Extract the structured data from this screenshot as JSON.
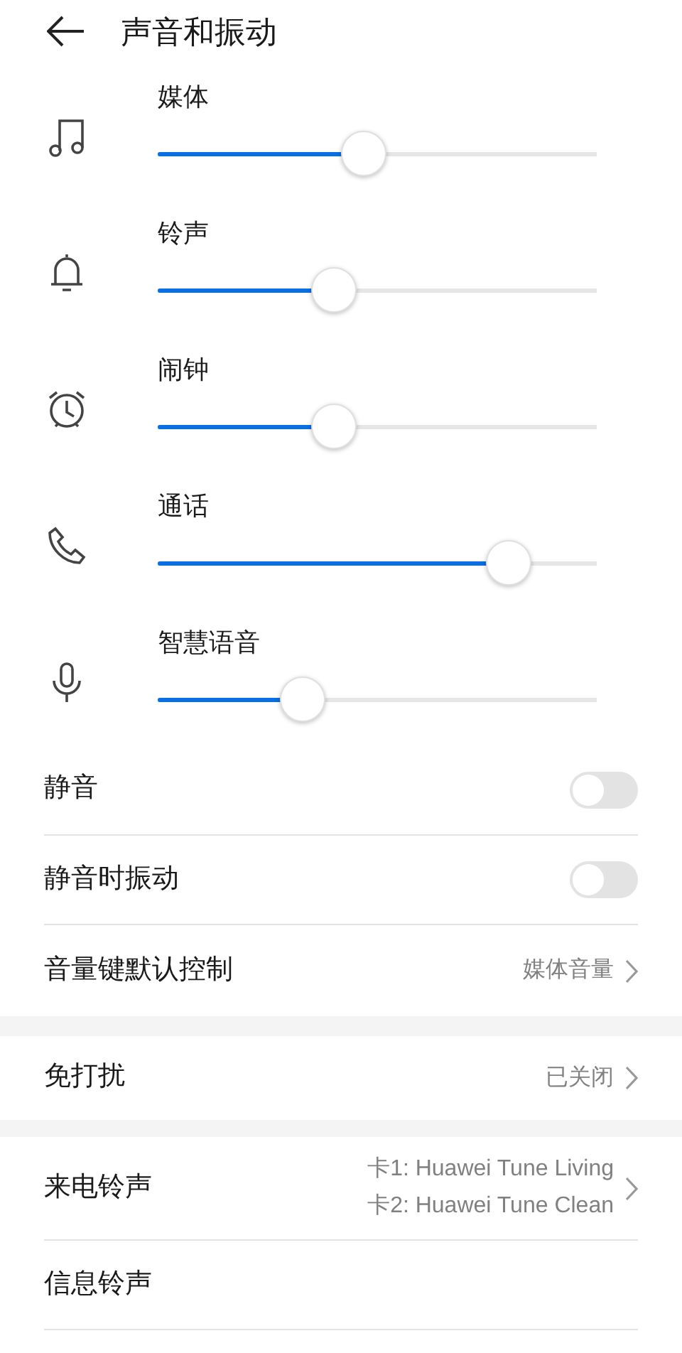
{
  "header": {
    "title": "声音和振动"
  },
  "volumes": [
    {
      "kind": "music",
      "label": "媒体",
      "level": 0.47
    },
    {
      "kind": "bell",
      "label": "铃声",
      "level": 0.4
    },
    {
      "kind": "alarm",
      "label": "闹钟",
      "level": 0.4
    },
    {
      "kind": "phone",
      "label": "通话",
      "level": 0.8
    },
    {
      "kind": "mic",
      "label": "智慧语音",
      "level": 0.33
    }
  ],
  "groups": [
    [
      {
        "kind": "toggle",
        "label": "静音",
        "on": false
      },
      {
        "kind": "toggle",
        "label": "静音时振动",
        "on": false
      },
      {
        "kind": "link",
        "label": "音量键默认控制",
        "values": [
          "媒体音量"
        ]
      }
    ],
    [
      {
        "kind": "link",
        "label": "免打扰",
        "values": [
          "已关闭"
        ]
      }
    ],
    [
      {
        "kind": "link",
        "label": "来电铃声",
        "values": [
          "卡1: Huawei Tune Living",
          "卡2: Huawei Tune Clean"
        ]
      },
      {
        "kind": "plain",
        "label": "信息铃声"
      }
    ]
  ]
}
